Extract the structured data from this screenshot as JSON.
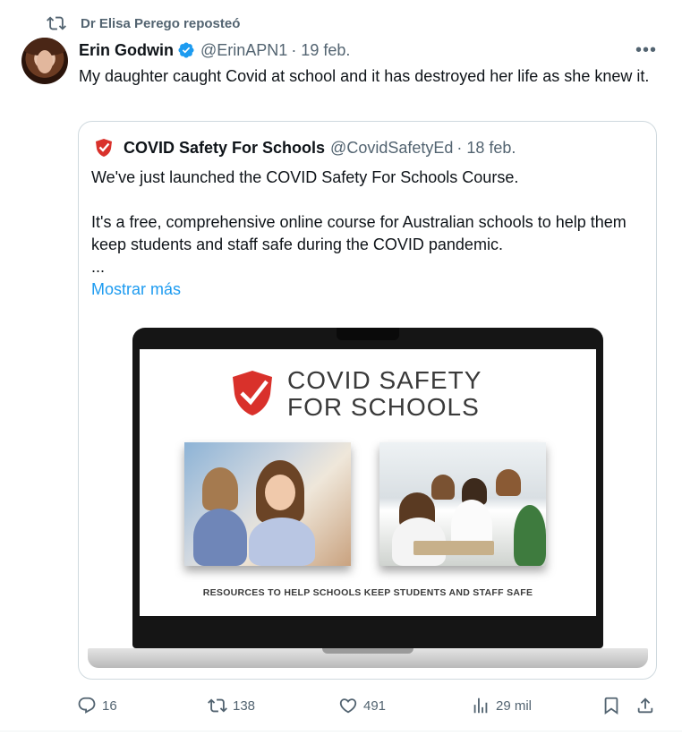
{
  "repost": {
    "label": "Dr Elisa Perego reposteó"
  },
  "tweet": {
    "author_name": "Erin Godwin",
    "handle": "@ErinAPN1",
    "date": "· 19 feb.",
    "more_label": "•••",
    "text": "My daughter caught Covid at school and it has destroyed her life as she knew it."
  },
  "quote": {
    "author_name": "COVID Safety For Schools",
    "handle": "@CovidSafetyEd",
    "date": "· 18 feb.",
    "para1": "We've just launched the COVID Safety For Schools Course.",
    "para2": "It's a free, comprehensive online course for Australian schools to help them keep students and staff safe during the COVID pandemic.",
    "ellipsis": "...",
    "show_more": "Mostrar más",
    "image": {
      "title": "COVID SAFETY\nFOR SCHOOLS",
      "footer": "RESOURCES TO HELP SCHOOLS KEEP STUDENTS AND STAFF SAFE"
    }
  },
  "actions": {
    "replies": "16",
    "reposts": "138",
    "likes": "491",
    "views": "29 mil"
  },
  "colors": {
    "accent": "#1d9bf0",
    "muted": "#536471",
    "brand_red": "#d9312b"
  }
}
